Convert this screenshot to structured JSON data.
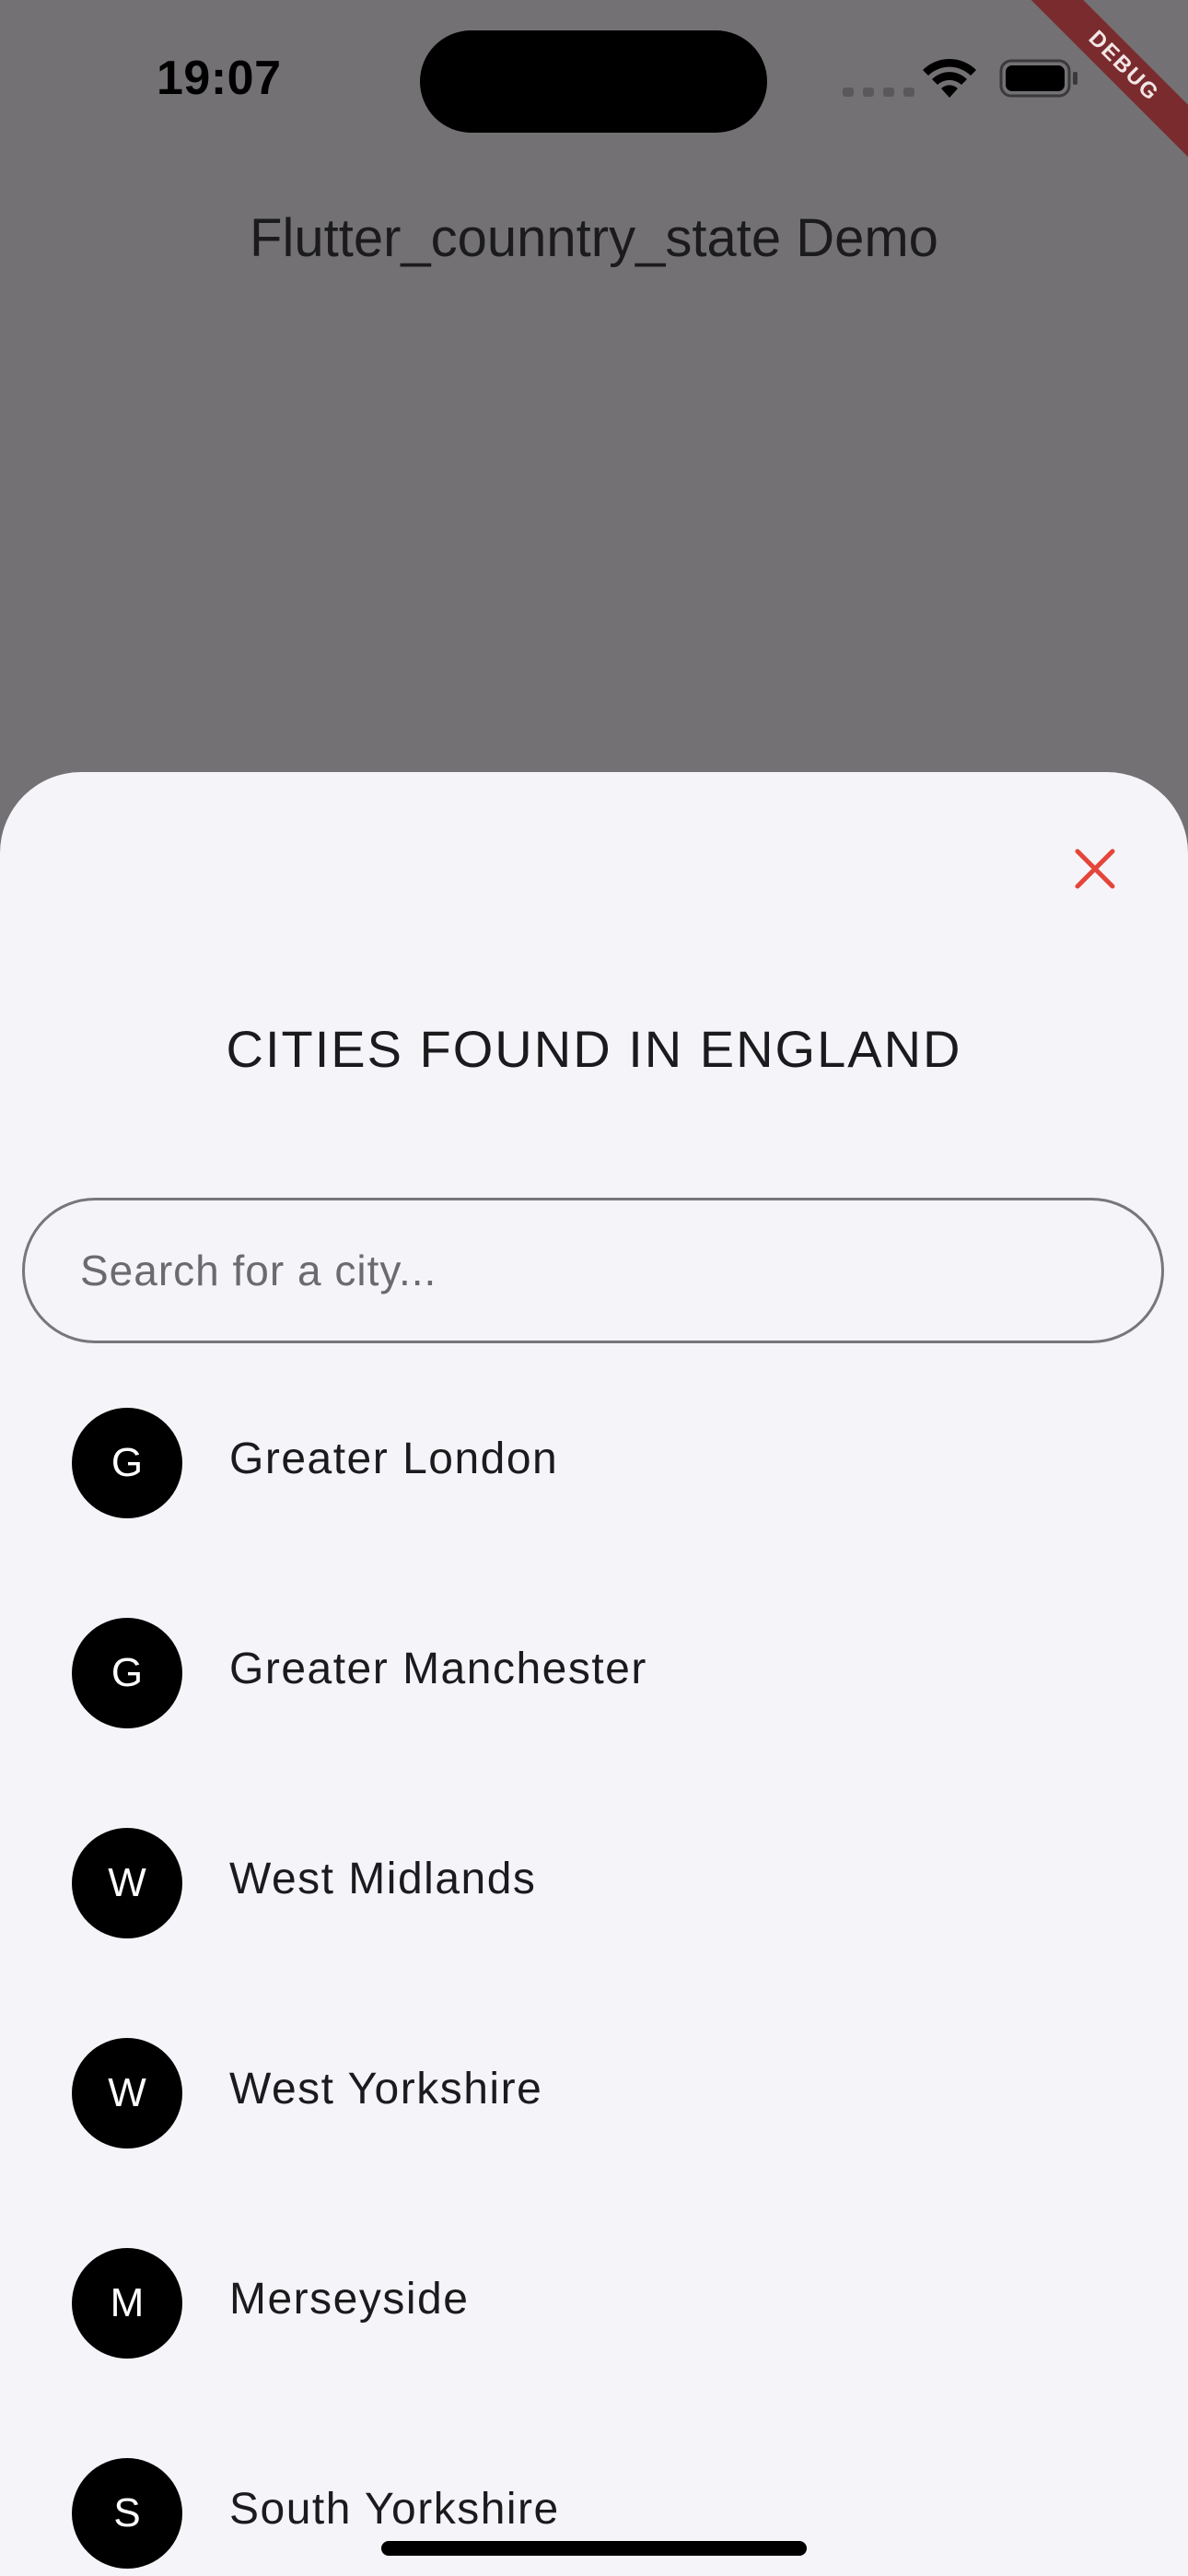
{
  "status_bar": {
    "time": "19:07",
    "debug_label": "DEBUG"
  },
  "app_bar": {
    "title": "Flutter_counntry_state Demo"
  },
  "sheet": {
    "title": "CITIES FOUND IN ENGLAND",
    "close_icon": "close-icon",
    "close_color": "#e5453a",
    "search": {
      "placeholder": "Search for a city...",
      "value": ""
    },
    "cities": [
      {
        "initial": "G",
        "name": "Greater London"
      },
      {
        "initial": "G",
        "name": "Greater Manchester"
      },
      {
        "initial": "W",
        "name": "West Midlands"
      },
      {
        "initial": "W",
        "name": "West Yorkshire"
      },
      {
        "initial": "M",
        "name": "Merseyside"
      },
      {
        "initial": "S",
        "name": "South Yorkshire"
      }
    ]
  }
}
